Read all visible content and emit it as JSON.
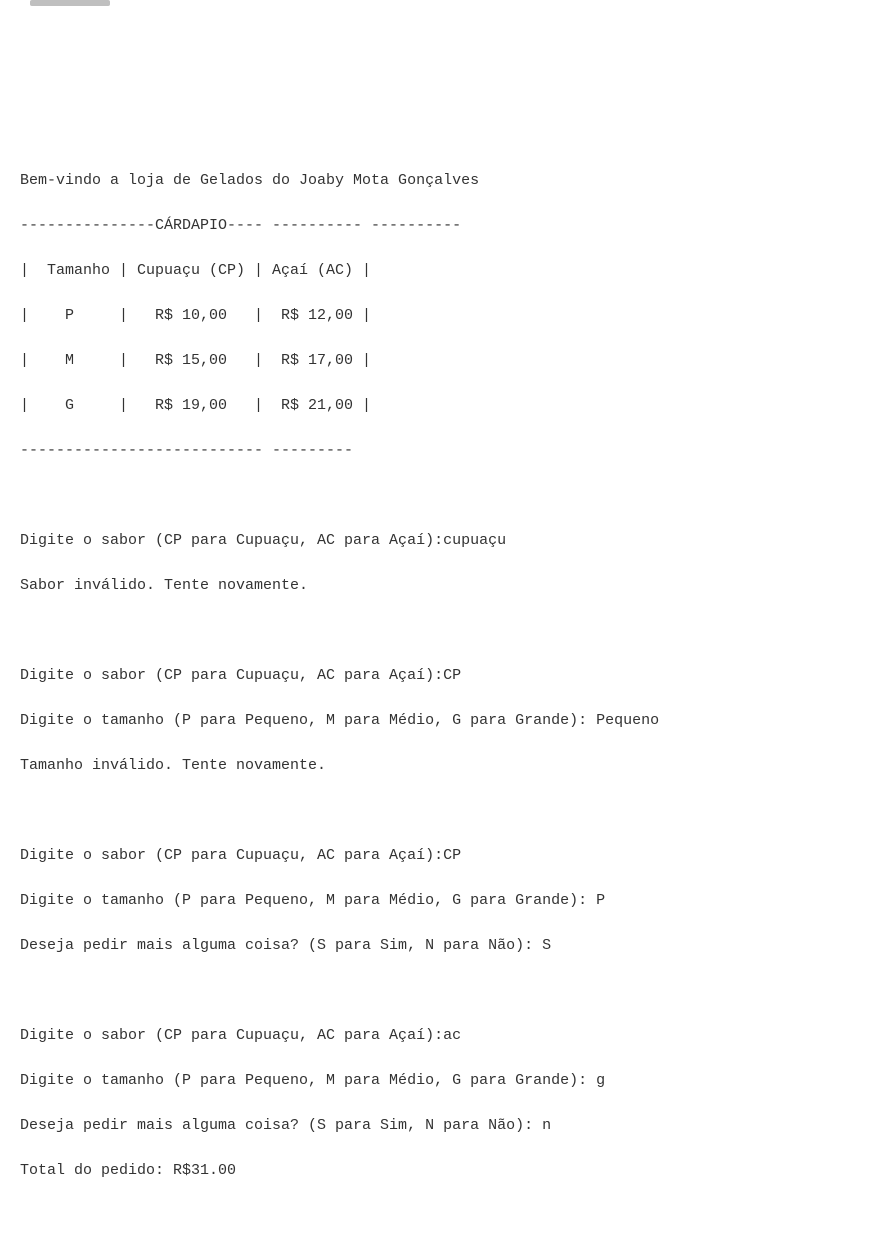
{
  "terminal": {
    "lines": [
      "Bem-vindo a loja de Gelados do Joaby Mota Gonçalves",
      "---------------CÁRDAPIO---- ---------- ----------",
      "|  Tamanho | Cupuaçu (CP) | Açaí (AC) |",
      "|    P     |   R$ 10,00   |  R$ 12,00 |",
      "|    M     |   R$ 15,00   |  R$ 17,00 |",
      "|    G     |   R$ 19,00   |  R$ 21,00 |",
      "--------------------------- ---------",
      "",
      "Digite o sabor (CP para Cupuaçu, AC para Açaí):cupuaçu",
      "Sabor inválido. Tente novamente.",
      "",
      "Digite o sabor (CP para Cupuaçu, AC para Açaí):CP",
      "Digite o tamanho (P para Pequeno, M para Médio, G para Grande): Pequeno",
      "Tamanho inválido. Tente novamente.",
      "",
      "Digite o sabor (CP para Cupuaçu, AC para Açaí):CP",
      "Digite o tamanho (P para Pequeno, M para Médio, G para Grande): P",
      "Deseja pedir mais alguma coisa? (S para Sim, N para Não): S",
      "",
      "Digite o sabor (CP para Cupuaçu, AC para Açaí):ac",
      "Digite o tamanho (P para Pequeno, M para Médio, G para Grande): g",
      "Deseja pedir mais alguma coisa? (S para Sim, N para Não): n",
      "Total do pedido: R$31.00"
    ]
  },
  "chart_data": {
    "type": "table",
    "title": "CÁRDAPIO",
    "columns": [
      "Tamanho",
      "Cupuaçu (CP)",
      "Açaí (AC)"
    ],
    "rows": [
      {
        "Tamanho": "P",
        "Cupuaçu (CP)": "R$ 10,00",
        "Açaí (AC)": "R$ 12,00"
      },
      {
        "Tamanho": "M",
        "Cupuaçu (CP)": "R$ 15,00",
        "Açaí (AC)": "R$ 17,00"
      },
      {
        "Tamanho": "G",
        "Cupuaçu (CP)": "R$ 19,00",
        "Açaí (AC)": "R$ 21,00"
      }
    ]
  },
  "session": {
    "store_owner": "Joaby Mota Gonçalves",
    "inputs": [
      {
        "prompt": "sabor",
        "value": "cupuaçu",
        "result": "Sabor inválido. Tente novamente."
      },
      {
        "prompt": "sabor",
        "value": "CP"
      },
      {
        "prompt": "tamanho",
        "value": "Pequeno",
        "result": "Tamanho inválido. Tente novamente."
      },
      {
        "prompt": "sabor",
        "value": "CP"
      },
      {
        "prompt": "tamanho",
        "value": "P"
      },
      {
        "prompt": "mais",
        "value": "S"
      },
      {
        "prompt": "sabor",
        "value": "ac"
      },
      {
        "prompt": "tamanho",
        "value": "g"
      },
      {
        "prompt": "mais",
        "value": "n"
      }
    ],
    "total": "R$31.00"
  }
}
